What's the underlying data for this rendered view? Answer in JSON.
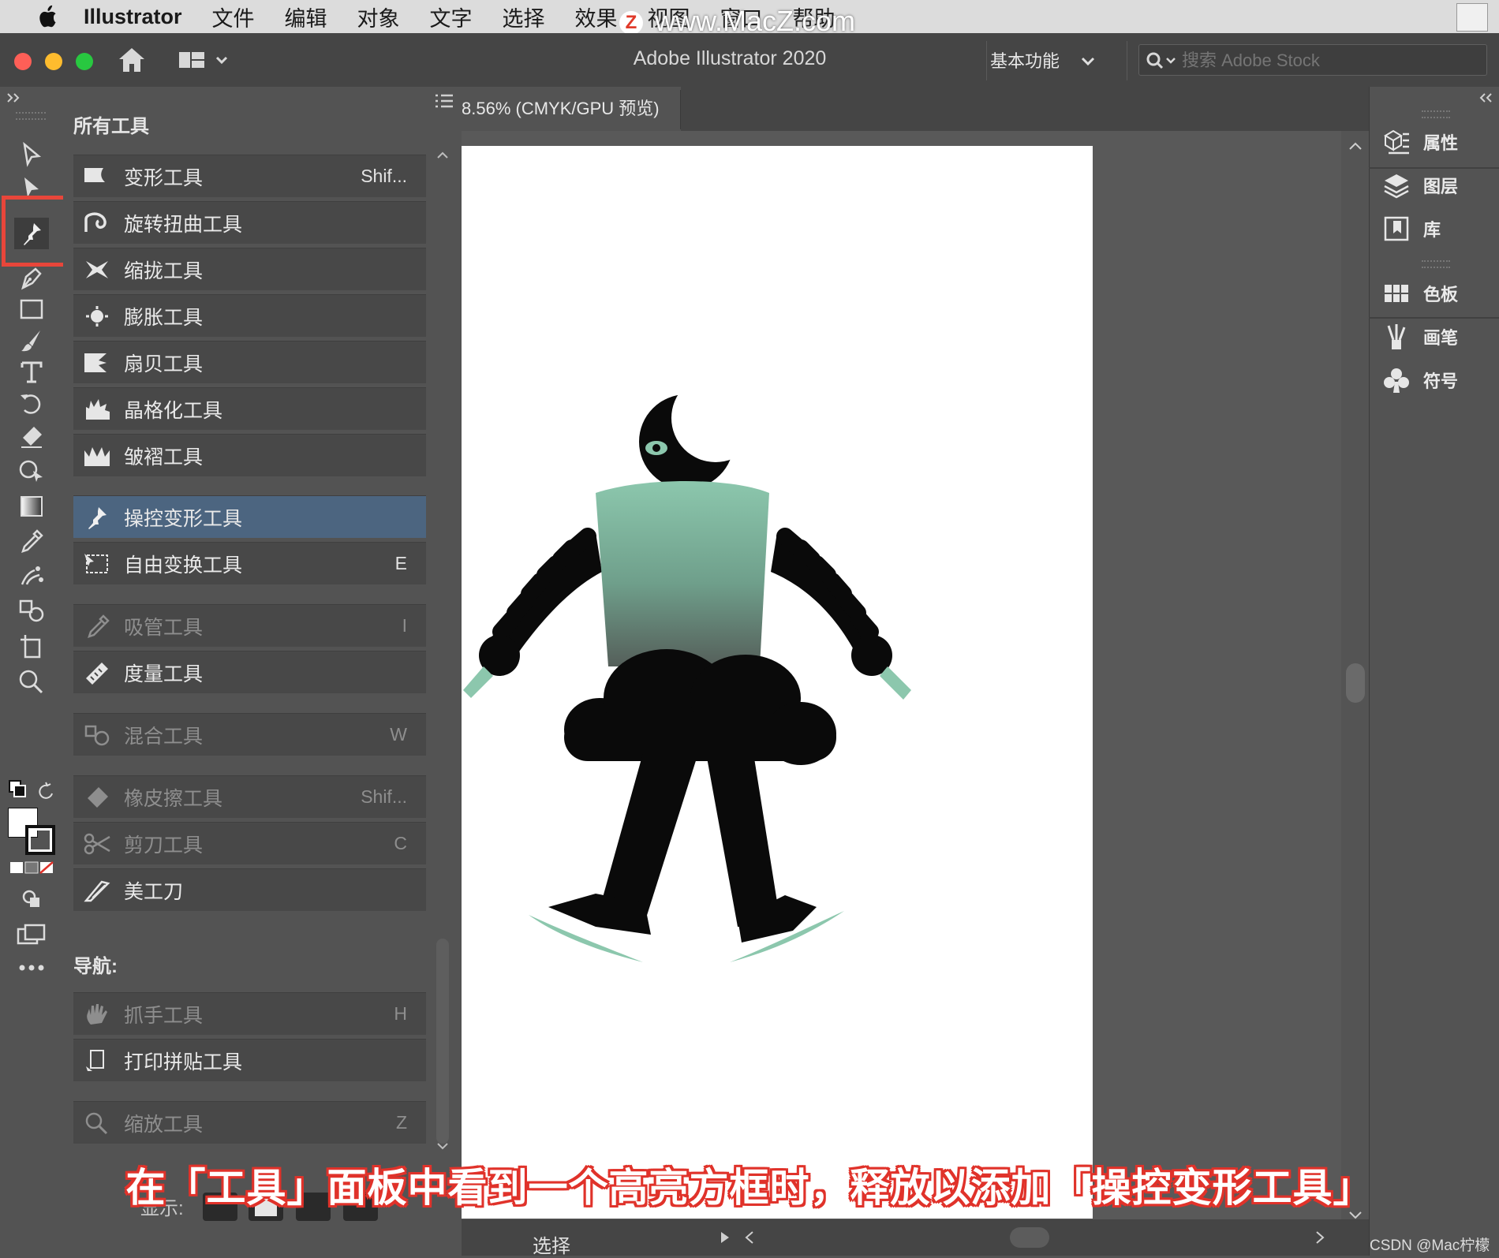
{
  "menubar": {
    "app_name": "Illustrator",
    "items": [
      "文件",
      "编辑",
      "对象",
      "文字",
      "选择",
      "效果",
      "视图",
      "窗口",
      "帮助"
    ],
    "watermark": "www.MacZ.com",
    "watermark_badge": "Z"
  },
  "titlebar": {
    "title": "Adobe Illustrator 2020",
    "workspace": "基本功能",
    "search_placeholder": "搜索 Adobe Stock"
  },
  "document_tab": {
    "label": "8.56% (CMYK/GPU 预览)"
  },
  "tools_panel": {
    "title": "所有工具",
    "group1": [
      {
        "label": "变形工具",
        "shortcut": "Shif...",
        "icon": "warp-icon"
      },
      {
        "label": "旋转扭曲工具",
        "shortcut": "",
        "icon": "twirl-icon"
      },
      {
        "label": "缩拢工具",
        "shortcut": "",
        "icon": "pucker-icon"
      },
      {
        "label": "膨胀工具",
        "shortcut": "",
        "icon": "bloat-icon"
      },
      {
        "label": "扇贝工具",
        "shortcut": "",
        "icon": "scallop-icon"
      },
      {
        "label": "晶格化工具",
        "shortcut": "",
        "icon": "crystallize-icon"
      },
      {
        "label": "皱褶工具",
        "shortcut": "",
        "icon": "wrinkle-icon"
      }
    ],
    "group2": [
      {
        "label": "操控变形工具",
        "shortcut": "",
        "icon": "puppet-pin-icon",
        "selected": true
      },
      {
        "label": "自由变换工具",
        "shortcut": "E",
        "icon": "free-transform-icon"
      }
    ],
    "group3": [
      {
        "label": "吸管工具",
        "shortcut": "I",
        "icon": "eyedropper-icon",
        "dimmed": true
      },
      {
        "label": "度量工具",
        "shortcut": "",
        "icon": "measure-icon"
      }
    ],
    "group4": [
      {
        "label": "混合工具",
        "shortcut": "W",
        "icon": "blend-icon",
        "dimmed": true
      }
    ],
    "group5": [
      {
        "label": "橡皮擦工具",
        "shortcut": "Shif...",
        "icon": "eraser-icon",
        "dimmed": true
      },
      {
        "label": "剪刀工具",
        "shortcut": "C",
        "icon": "scissors-icon",
        "dimmed": true
      },
      {
        "label": "美工刀",
        "shortcut": "",
        "icon": "knife-icon"
      }
    ],
    "nav_label": "导航:",
    "group6": [
      {
        "label": "抓手工具",
        "shortcut": "H",
        "icon": "hand-icon",
        "dimmed": true
      },
      {
        "label": "打印拼贴工具",
        "shortcut": "",
        "icon": "print-tiling-icon"
      }
    ],
    "group7": [
      {
        "label": "缩放工具",
        "shortcut": "Z",
        "icon": "zoom-icon",
        "dimmed": true
      }
    ],
    "display_label": "显示:"
  },
  "right_dock": {
    "items": [
      {
        "label": "属性",
        "icon": "properties-icon"
      },
      {
        "label": "图层",
        "icon": "layers-icon"
      },
      {
        "label": "库",
        "icon": "libraries-icon"
      },
      {
        "label": "色板",
        "icon": "swatches-icon"
      },
      {
        "label": "画笔",
        "icon": "brushes-icon"
      },
      {
        "label": "符号",
        "icon": "symbols-icon"
      }
    ]
  },
  "statusbar": {
    "tool_label": "选择"
  },
  "caption": "在「工具」面板中看到一个高亮方框时，释放以添加「操控变形工具」",
  "credit": "CSDN @Mac柠檬",
  "colors": {
    "highlight": "#e8463a",
    "selected_row": "#4c6580",
    "figure_green": "#8cc7ad",
    "figure_black": "#0a0a0a"
  }
}
